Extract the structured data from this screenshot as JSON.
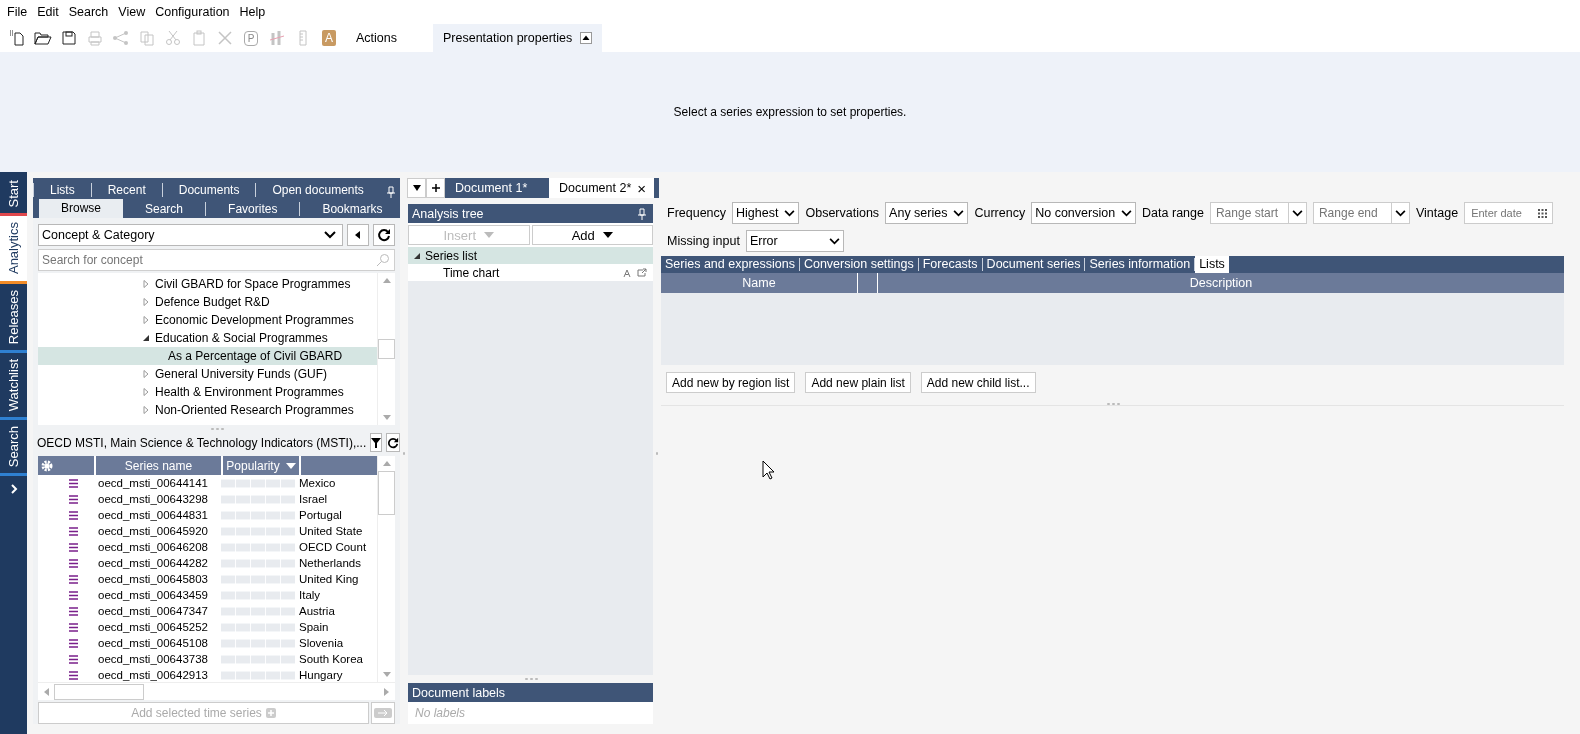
{
  "menu": [
    "File",
    "Edit",
    "Search",
    "View",
    "Configuration",
    "Help"
  ],
  "toolbar": {
    "icons": [
      {
        "kind": "new",
        "disabled": false
      },
      {
        "kind": "open",
        "disabled": false
      },
      {
        "kind": "save",
        "disabled": false
      },
      {
        "kind": "print",
        "disabled": true
      },
      {
        "kind": "share",
        "disabled": true
      },
      {
        "kind": "copy",
        "disabled": true
      },
      {
        "kind": "cut",
        "disabled": true
      },
      {
        "kind": "paste",
        "disabled": true
      },
      {
        "kind": "delete",
        "disabled": true
      },
      {
        "kind": "letter",
        "label": "P",
        "disabled": true
      },
      {
        "kind": "chart",
        "disabled": true
      },
      {
        "kind": "ruler",
        "disabled": true
      },
      {
        "kind": "letterfill",
        "label": "A",
        "disabled": true
      }
    ],
    "actions": "Actions",
    "panel_tab": "Presentation properties"
  },
  "properties_message": "Select a series expression to set properties.",
  "side_tabs": [
    {
      "label": "Start",
      "selected": false,
      "color": "#e0474c"
    },
    {
      "label": "Analytics",
      "selected": true,
      "color": "#f28c28"
    },
    {
      "label": "Releases",
      "selected": false,
      "color": "#2f80d1"
    },
    {
      "label": "Watchlist",
      "selected": false,
      "color": "#2f80d1"
    },
    {
      "label": "Search",
      "selected": false,
      "color": "#2f80d1"
    }
  ],
  "browser": {
    "tabs_row1": [
      {
        "label": "Lists",
        "selected": false
      },
      {
        "label": "Recent",
        "selected": false
      },
      {
        "label": "Documents",
        "selected": false
      },
      {
        "label": "Open documents",
        "selected": false
      }
    ],
    "tabs_row2": [
      {
        "label": "Browse",
        "selected": true
      },
      {
        "label": "Search",
        "selected": false
      },
      {
        "label": "Favorites",
        "selected": false
      },
      {
        "label": "Bookmarks",
        "selected": false
      }
    ],
    "view_select": "Concept & Category",
    "search": {
      "placeholder": "Search for concept"
    },
    "tree": [
      {
        "label": "Civil GBARD for Space Programmes",
        "expanded": false,
        "selected": false
      },
      {
        "label": "Defence Budget R&D",
        "expanded": false,
        "selected": false
      },
      {
        "label": "Economic Development Programmes",
        "expanded": false,
        "selected": false
      },
      {
        "label": "Education & Social Programmes",
        "expanded": true,
        "selected": false,
        "children": [
          {
            "label": "As a Percentage of Civil GBARD",
            "selected": true
          }
        ]
      },
      {
        "label": "General University Funds (GUF)",
        "expanded": false,
        "selected": false
      },
      {
        "label": "Health & Environment Programmes",
        "expanded": false,
        "selected": false
      },
      {
        "label": "Non-Oriented Research Programmes",
        "expanded": false,
        "selected": false
      }
    ],
    "source": "OECD MSTI, Main Science & Technology Indicators (MSTI),...",
    "columns": [
      "Series name",
      "Popularity"
    ],
    "rows": [
      {
        "name": "oecd_msti_00644141",
        "column_4": "Mexico"
      },
      {
        "name": "oecd_msti_00643298",
        "column_4": "Israel"
      },
      {
        "name": "oecd_msti_00644831",
        "column_4": "Portugal"
      },
      {
        "name": "oecd_msti_00645920",
        "column_4": "United State"
      },
      {
        "name": "oecd_msti_00646208",
        "column_4": "OECD Count"
      },
      {
        "name": "oecd_msti_00644282",
        "column_4": "Netherlands"
      },
      {
        "name": "oecd_msti_00645803",
        "column_4": "United King"
      },
      {
        "name": "oecd_msti_00643459",
        "column_4": "Italy"
      },
      {
        "name": "oecd_msti_00647347",
        "column_4": "Austria"
      },
      {
        "name": "oecd_msti_00645252",
        "column_4": "Spain"
      },
      {
        "name": "oecd_msti_00645108",
        "column_4": "Slovenia"
      },
      {
        "name": "oecd_msti_00643738",
        "column_4": "South Korea"
      },
      {
        "name": "oecd_msti_00642913",
        "column_4": "Hungary"
      }
    ],
    "add_button": "Add selected time series"
  },
  "documents": {
    "tabs": [
      {
        "label": "Document 1*",
        "selected": false
      },
      {
        "label": "Document 2*",
        "selected": true
      }
    ],
    "close": "×"
  },
  "analysis_tree": {
    "title": "Analysis tree",
    "insert": "Insert",
    "add": "Add",
    "items": [
      {
        "label": "Series list",
        "expanded": true,
        "selected": true,
        "children": [
          {
            "label": "Time chart",
            "selected": false
          }
        ]
      }
    ]
  },
  "document_labels": {
    "title": "Document labels",
    "empty": "No labels"
  },
  "settings": {
    "fields": [
      {
        "label": "Frequency",
        "value": "Highest",
        "kind": "select"
      },
      {
        "label": "Observations",
        "value": "Any series",
        "kind": "select"
      },
      {
        "label": "Currency",
        "value": "No conversion",
        "kind": "select"
      },
      {
        "label": "Data range",
        "placeholder": "Range start",
        "kind": "combo"
      },
      {
        "placeholder": "Range end",
        "kind": "combo"
      },
      {
        "label": "Vintage",
        "placeholder": "Enter date",
        "kind": "date"
      },
      {
        "label": "Missing input",
        "value": "Error",
        "kind": "select"
      }
    ],
    "tabs": [
      {
        "label": "Series and expressions",
        "selected": false
      },
      {
        "label": "Conversion settings",
        "selected": false
      },
      {
        "label": "Forecasts",
        "selected": false
      },
      {
        "label": "Document series",
        "selected": false
      },
      {
        "label": "Series information",
        "selected": false
      },
      {
        "label": "Lists",
        "selected": true
      }
    ],
    "columns": [
      "Name",
      "Description"
    ],
    "buttons": [
      "Add new by region list",
      "Add new plain list",
      "Add new child list..."
    ]
  }
}
